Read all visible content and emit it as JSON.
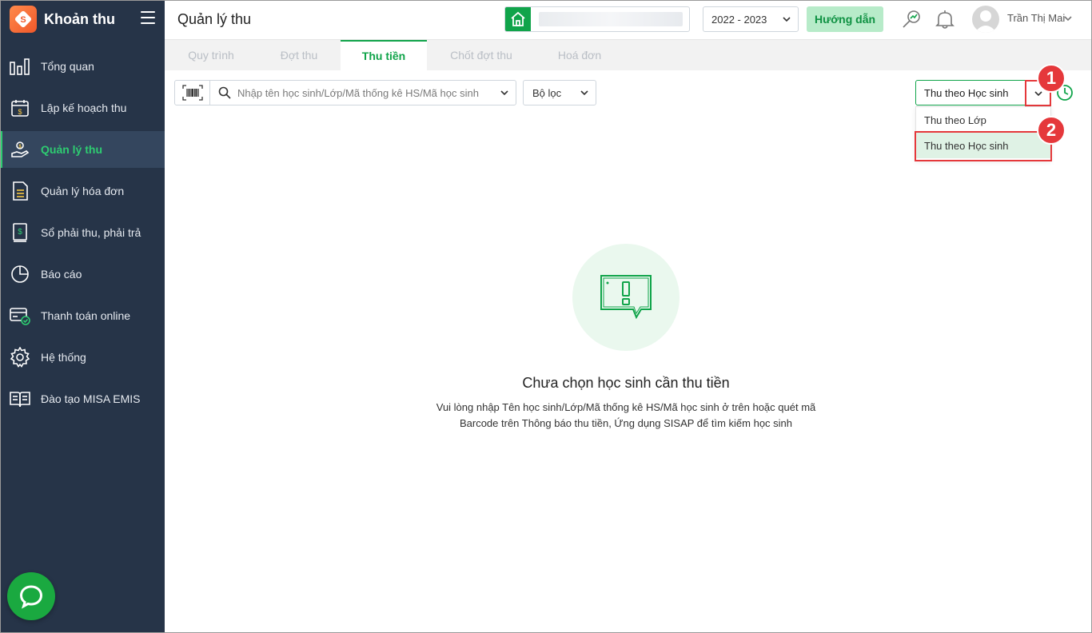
{
  "app": {
    "brand": "Khoản thu"
  },
  "sidebar": {
    "items": [
      {
        "label": "Tổng quan",
        "icon": "bar-chart-icon"
      },
      {
        "label": "Lập kế hoạch thu",
        "icon": "calendar-dollar-icon"
      },
      {
        "label": "Quản lý thu",
        "icon": "hand-coin-icon",
        "active": true
      },
      {
        "label": "Quản lý hóa đơn",
        "icon": "document-icon"
      },
      {
        "label": "Sổ phải thu, phải trả",
        "icon": "ledger-icon"
      },
      {
        "label": "Báo cáo",
        "icon": "pie-chart-icon"
      },
      {
        "label": "Thanh toán online",
        "icon": "card-check-icon"
      },
      {
        "label": "Hệ thống",
        "icon": "gear-icon"
      },
      {
        "label": "Đào tạo MISA EMIS",
        "icon": "open-book-icon"
      }
    ]
  },
  "header": {
    "title": "Quản lý thu",
    "school_name": "",
    "year": "2022 - 2023",
    "guide_label": "Hướng dẫn",
    "user_name": "Trần Thị Mai"
  },
  "tabs": [
    {
      "label": "Quy trình"
    },
    {
      "label": "Đợt thu"
    },
    {
      "label": "Thu tiền",
      "active": true
    },
    {
      "label": "Chốt đợt thu"
    },
    {
      "label": "Hoá đơn"
    }
  ],
  "toolbar": {
    "search_placeholder": "Nhập tên học sinh/Lớp/Mã thống kê HS/Mã học sinh",
    "filter_label": "Bộ lọc",
    "mode_selected": "Thu theo Học sinh",
    "mode_options": [
      "Thu theo Lớp",
      "Thu theo Học sinh"
    ]
  },
  "annotations": {
    "step1": "1",
    "step2": "2",
    "highlight_color": "#e5383b"
  },
  "empty_state": {
    "title": "Chưa chọn học sinh cần thu tiền",
    "desc_line1": "Vui lòng nhập Tên học sinh/Lớp/Mã thống kê HS/Mã học sinh ở trên hoặc quét mã",
    "desc_line2": "Barcode trên Thông báo thu tiền, Ứng dụng SISAP để tìm kiếm học sinh"
  },
  "colors": {
    "sidebar_bg": "#263448",
    "accent": "#10a44a",
    "active_text": "#2ecc71"
  }
}
